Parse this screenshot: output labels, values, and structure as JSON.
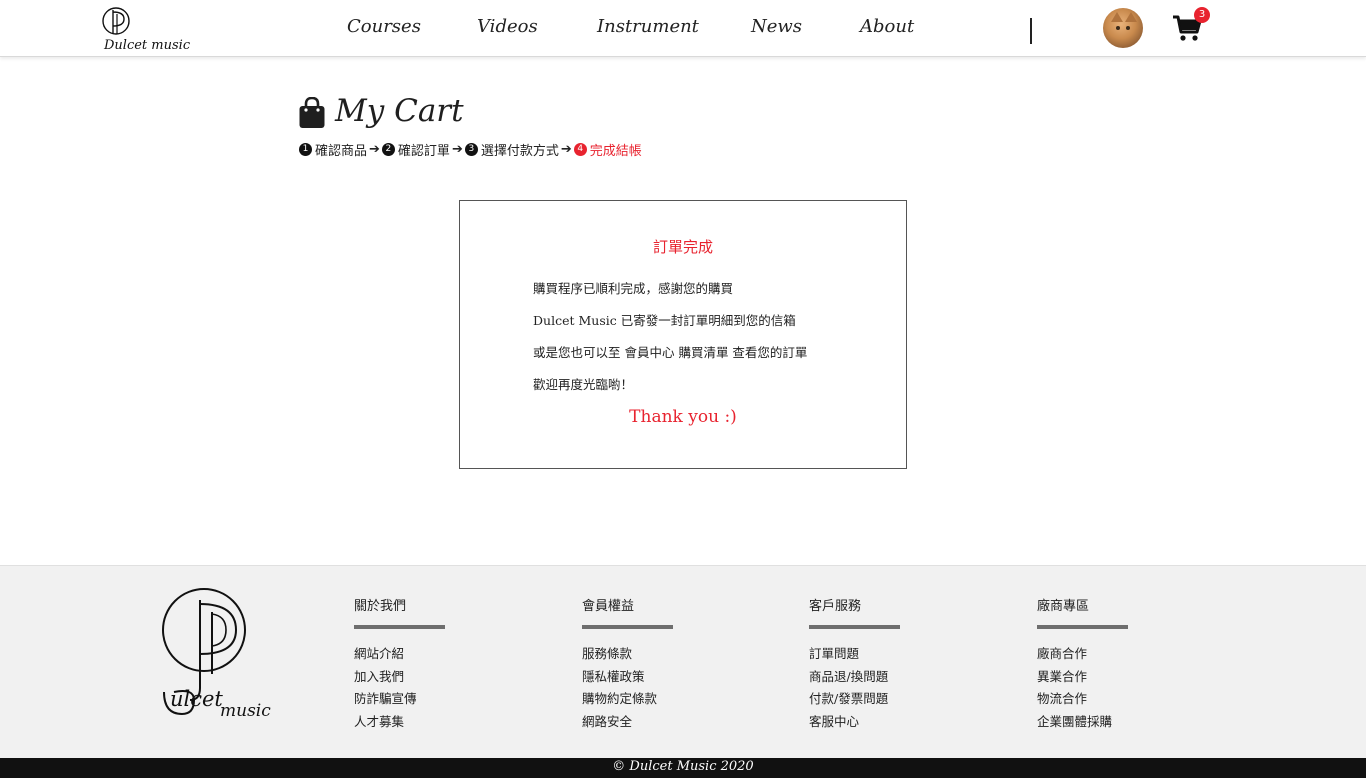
{
  "header": {
    "logo_text": "Dulcet music",
    "nav": [
      {
        "label": "Courses"
      },
      {
        "label": "Videos"
      },
      {
        "label": "Instrument"
      },
      {
        "label": "News"
      },
      {
        "label": "About"
      }
    ],
    "cart_count": "3"
  },
  "main": {
    "title": "My Cart",
    "steps": [
      {
        "num": "1",
        "label": "確認商品",
        "active": false
      },
      {
        "num": "2",
        "label": "確認訂單",
        "active": false
      },
      {
        "num": "3",
        "label": "選擇付款方式",
        "active": false
      },
      {
        "num": "4",
        "label": "完成結帳",
        "active": true
      }
    ],
    "arrow": "➔",
    "order": {
      "title": "訂單完成",
      "lines": [
        "購買程序已順利完成，感謝您的購買",
        "Dulcet Music 已寄發一封訂單明細到您的信箱",
        "或是您也可以至 會員中心 購買清單 查看您的訂單",
        "歡迎再度光臨喲！"
      ],
      "thanks": "Thank you :)"
    }
  },
  "footer": {
    "logo_text": "Dulcet music",
    "columns": [
      {
        "title": "關於我們",
        "links": [
          "網站介紹",
          "加入我們",
          "防詐騙宣傳",
          "人才募集"
        ]
      },
      {
        "title": "會員權益",
        "links": [
          "服務條款",
          "隱私權政策",
          "購物約定條款",
          "網路安全"
        ]
      },
      {
        "title": "客戶服務",
        "links": [
          "訂單問題",
          "商品退/換問題",
          "付款/發票問題",
          "客服中心"
        ]
      },
      {
        "title": "廠商專區",
        "links": [
          "廠商合作",
          "異業合作",
          "物流合作",
          "企業團體採購"
        ]
      }
    ],
    "copyright": "© Dulcet Music 2020"
  },
  "colors": {
    "accent": "#e8232f",
    "footer_bg": "#f1f1f1",
    "copyright_bg": "#111111"
  }
}
